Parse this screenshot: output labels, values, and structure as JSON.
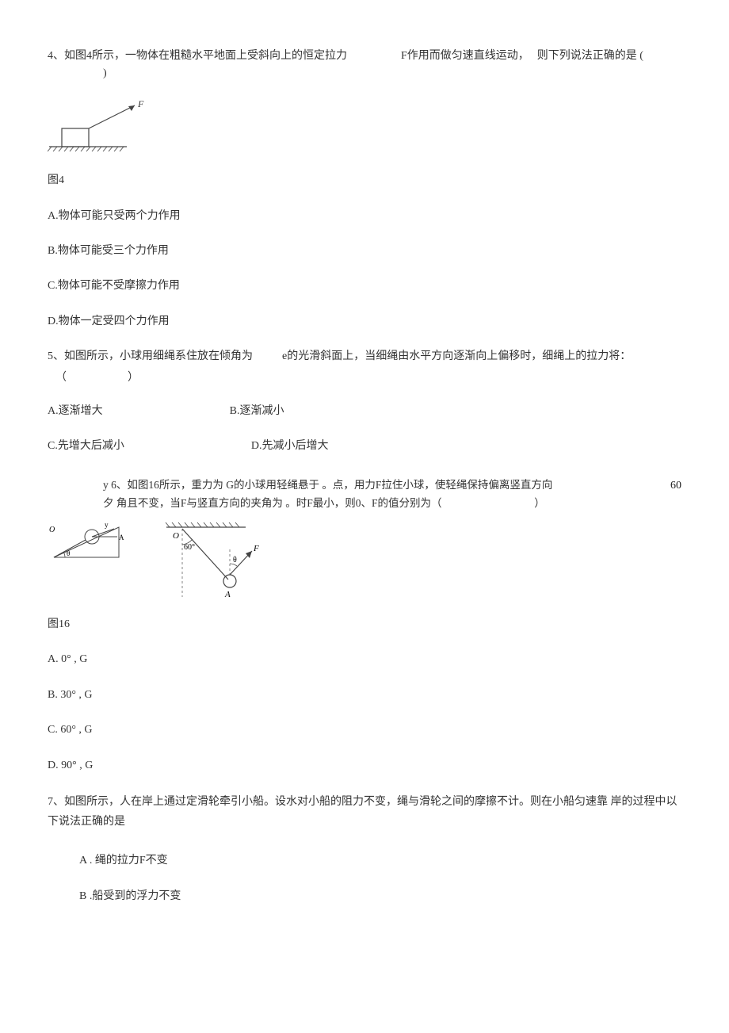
{
  "q4": {
    "stem_a": "4、如图4所示，一物体在粗糙水平地面上受斜向上的恒定拉力",
    "stem_b": "F作用而做匀速直线运动，",
    "stem_c": "则下列说法正确的是 (",
    "stem_d": ")",
    "fig_label": "图4",
    "opts": {
      "A": "A.物体可能只受两个力作用",
      "B": "B.物体可能受三个力作用",
      "C": "C.物体可能不受摩擦力作用",
      "D": "D.物体一定受四个力作用"
    },
    "force_label": "F"
  },
  "q5": {
    "stem_a": "5、如图所示，小球用细绳系住放在倾角为",
    "stem_b": "e的光滑斜面上，当细绳由水平方向逐渐向上偏移时，细绳上的拉力将：",
    "paren_l": "（",
    "paren_r": "）",
    "opts": {
      "A": "A.逐渐增大",
      "B": "B.逐渐减小",
      "C": "C.先增大后减小",
      "D": "D.先减小后增大"
    }
  },
  "q6": {
    "prefix": "y 6、如图16所示，重力为 G的小球用轻绳悬于 。点，用力F拉住小球，使轻绳保持偏离竖直方向",
    "right_num": "60",
    "line2": "夕 角且不变，当F与竖直方向的夹角为 。时F最小，则0、F的值分别为（",
    "paren_r": "）",
    "fig_label": "图16",
    "angle_label": "60°",
    "o_label": "O",
    "a_label": "A",
    "f_label": "F",
    "theta_label": "θ",
    "opts": {
      "A": "A.   0° , G",
      "B": "B.   30° , G",
      "C": "C.   60° , G",
      "D": "D.   90° , G"
    }
  },
  "q7": {
    "stem": "7、如图所示，人在岸上通过定滑轮牵引小船。设水对小船的阻力不变，绳与滑轮之间的摩擦不计。则在小船匀速靠 岸的过程中以下说法正确的是",
    "opts": {
      "A": "A . 绳的拉力F不变",
      "B": "B .船受到的浮力不变"
    }
  }
}
